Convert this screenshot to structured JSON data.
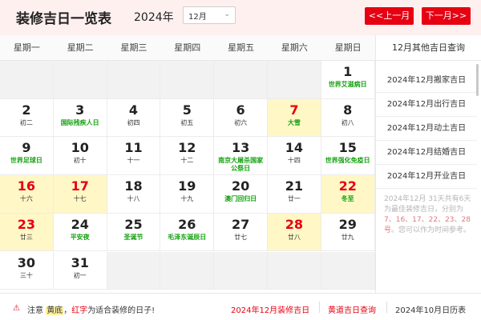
{
  "header": {
    "title": "装修吉日一览表",
    "year": "2024年",
    "month": "12月",
    "prev_label": "<<上一月",
    "next_label": "下一月>>"
  },
  "weekdays": [
    "星期一",
    "星期二",
    "星期三",
    "星期四",
    "星期五",
    "星期六",
    "星期日"
  ],
  "sidebar": {
    "title": "12月其他吉日查询",
    "links": [
      "2024年12月搬家吉日",
      "2024年12月出行吉日",
      "2024年12月动土吉日",
      "2024年12月结婚吉日",
      "2024年12月开业吉日"
    ],
    "note_prefix": "2024年12月 31天共有6天为最佳装修吉日，分别为",
    "note_days": "7、16、17、22、23、28号",
    "note_suffix": "。您可以作为时间参考。"
  },
  "calendar": {
    "days": [
      {
        "day": "",
        "sub": ""
      },
      {
        "day": "",
        "sub": ""
      },
      {
        "day": "",
        "sub": ""
      },
      {
        "day": "",
        "sub": ""
      },
      {
        "day": "",
        "sub": ""
      },
      {
        "day": "",
        "sub": ""
      },
      {
        "day": "1",
        "sub": "世界艾滋病日",
        "fest": true
      },
      {
        "day": "2",
        "sub": "初二"
      },
      {
        "day": "3",
        "sub": "国际残疾人日",
        "fest": true
      },
      {
        "day": "4",
        "sub": "初四"
      },
      {
        "day": "5",
        "sub": "初五"
      },
      {
        "day": "6",
        "sub": "初六"
      },
      {
        "day": "7",
        "sub": "大雪",
        "fest": true,
        "good": true
      },
      {
        "day": "8",
        "sub": "初八"
      },
      {
        "day": "9",
        "sub": "世界足球日",
        "fest": true
      },
      {
        "day": "10",
        "sub": "初十"
      },
      {
        "day": "11",
        "sub": "十一"
      },
      {
        "day": "12",
        "sub": "十二"
      },
      {
        "day": "13",
        "sub": "南京大屠杀国家公祭日",
        "fest": true
      },
      {
        "day": "14",
        "sub": "十四"
      },
      {
        "day": "15",
        "sub": "世界强化免疫日",
        "fest": true
      },
      {
        "day": "16",
        "sub": "十六",
        "good": true
      },
      {
        "day": "17",
        "sub": "十七",
        "good": true
      },
      {
        "day": "18",
        "sub": "十八"
      },
      {
        "day": "19",
        "sub": "十九"
      },
      {
        "day": "20",
        "sub": "澳门回归日",
        "fest": true
      },
      {
        "day": "21",
        "sub": "廿一"
      },
      {
        "day": "22",
        "sub": "冬至",
        "fest": true,
        "good": true
      },
      {
        "day": "23",
        "sub": "廿三",
        "good": true
      },
      {
        "day": "24",
        "sub": "平安夜",
        "fest": true
      },
      {
        "day": "25",
        "sub": "圣诞节",
        "fest": true
      },
      {
        "day": "26",
        "sub": "毛泽东诞辰日",
        "fest": true
      },
      {
        "day": "27",
        "sub": "廿七"
      },
      {
        "day": "28",
        "sub": "廿八",
        "good": true
      },
      {
        "day": "29",
        "sub": "廿九"
      },
      {
        "day": "30",
        "sub": "三十"
      },
      {
        "day": "31",
        "sub": "初一"
      },
      {
        "day": "",
        "sub": ""
      },
      {
        "day": "",
        "sub": ""
      },
      {
        "day": "",
        "sub": ""
      },
      {
        "day": "",
        "sub": ""
      },
      {
        "day": "",
        "sub": ""
      }
    ]
  },
  "footer": {
    "note_a": "注意 ",
    "note_yellow": "黄底",
    "note_b": "，",
    "note_red": "红字",
    "note_c": "为适合装修的日子!",
    "link1": "2024年12月装修吉日",
    "link2": "黄道吉日查询",
    "link3": "2024年10月日历表"
  },
  "colors": {
    "accent": "#e60012",
    "highlight": "#fff7c6",
    "festival": "#13a10e"
  }
}
